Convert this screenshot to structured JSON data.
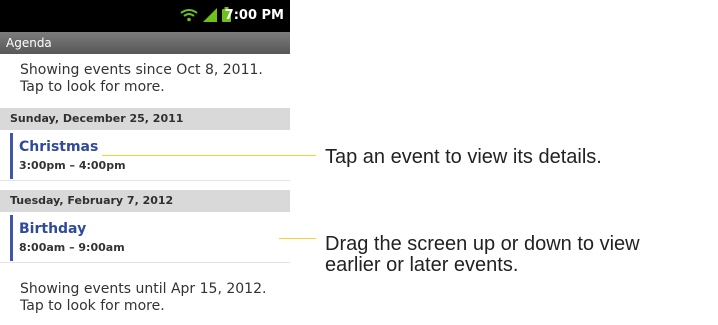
{
  "status_bar": {
    "time": "7:00 PM",
    "icons": [
      "wifi-icon",
      "signal-icon",
      "battery-icon"
    ],
    "colors": {
      "background": "#000000",
      "icons": "#6fbf1f"
    }
  },
  "title_bar": {
    "title": "Agenda"
  },
  "agenda": {
    "top_notice": {
      "line1": "Showing events since Oct 8, 2011.",
      "line2": "Tap to look for more."
    },
    "days": [
      {
        "date": "Sunday, December 25, 2011",
        "events": [
          {
            "title": "Christmas",
            "time": "3:00pm – 4:00pm"
          }
        ]
      },
      {
        "date": "Tuesday, February 7, 2012",
        "events": [
          {
            "title": "Birthday",
            "time": "8:00am – 9:00am"
          }
        ]
      }
    ],
    "bottom_notice": {
      "line1": "Showing events until Apr 15, 2012.",
      "line2": "Tap to look for more."
    },
    "colors": {
      "event_title": "#2f4a9a",
      "event_marker": "#3f57a6",
      "date_header_bg": "#d9d9d9"
    }
  },
  "callouts": {
    "event": {
      "text": "Tap an event to view its details."
    },
    "scroll": {
      "line1": "Drag the screen up or down to view",
      "line2": "earlier or later events."
    },
    "line_color": "#f5d430"
  }
}
